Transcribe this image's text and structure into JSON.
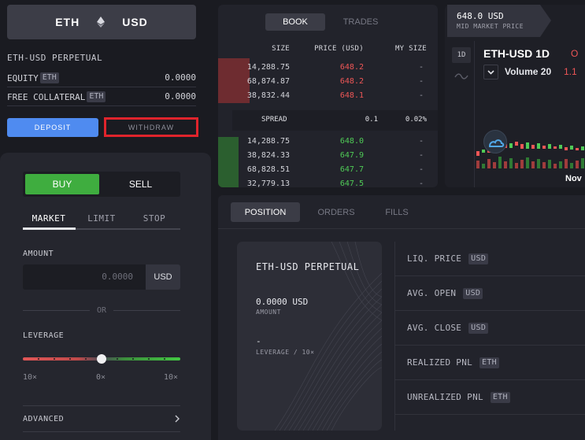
{
  "market": {
    "base": "ETH",
    "quote": "USD",
    "name": "ETH-USD PERPETUAL"
  },
  "account": {
    "equity_label": "EQUITY",
    "equity_tag": "ETH",
    "equity_value": "0.0000",
    "collateral_label": "FREE COLLATERAL",
    "collateral_tag": "ETH",
    "collateral_value": "0.0000",
    "deposit_label": "DEPOSIT",
    "withdraw_label": "WITHDRAW"
  },
  "trade": {
    "buy_label": "BUY",
    "sell_label": "SELL",
    "order_tabs": [
      "MARKET",
      "LIMIT",
      "STOP"
    ],
    "amount_label": "AMOUNT",
    "amount_placeholder": "0.0000",
    "amount_unit": "USD",
    "or_label": "OR",
    "leverage_label": "LEVERAGE",
    "leverage_ticks": [
      "10×",
      "0×",
      "10×"
    ],
    "leverage_value": 0,
    "advanced_label": "ADVANCED"
  },
  "orderbook": {
    "tabs": [
      "BOOK",
      "TRADES"
    ],
    "headers": {
      "size": "SIZE",
      "price": "PRICE (USD)",
      "my_size": "MY SIZE"
    },
    "asks": [
      {
        "size": "14,288.75",
        "price": "648.2",
        "my": "-"
      },
      {
        "size": "68,874.87",
        "price": "648.2",
        "my": "-"
      },
      {
        "size": "38,832.44",
        "price": "648.1",
        "my": "-"
      }
    ],
    "spread": {
      "label": "SPREAD",
      "value": "0.1",
      "percent": "0.02%"
    },
    "bids": [
      {
        "size": "14,288.75",
        "price": "648.0",
        "my": "-"
      },
      {
        "size": "38,824.33",
        "price": "647.9",
        "my": "-"
      },
      {
        "size": "68,828.51",
        "price": "647.7",
        "my": "-"
      },
      {
        "size": "32,779.13",
        "price": "647.5",
        "my": "-"
      }
    ]
  },
  "chart": {
    "mid_price": "648.0 USD",
    "mid_label": "MID MARKET PRICE",
    "timeframe": "1D",
    "symbol": "ETH-USD  1D",
    "open_prefix": "O",
    "volume_label": "Volume 20",
    "volume_value": "1.1",
    "month_label": "Nov"
  },
  "position": {
    "tabs": [
      "POSITION",
      "ORDERS",
      "FILLS"
    ],
    "card_title": "ETH-USD PERPETUAL",
    "amount_value": "0.0000 USD",
    "amount_label": "AMOUNT",
    "leverage_value": "-",
    "leverage_label": "LEVERAGE / 10×",
    "stats": [
      {
        "label": "LIQ. PRICE",
        "tag": "USD"
      },
      {
        "label": "AVG. OPEN",
        "tag": "USD"
      },
      {
        "label": "AVG. CLOSE",
        "tag": "USD"
      },
      {
        "label": "REALIZED PNL",
        "tag": "ETH"
      },
      {
        "label": "UNREALIZED PNL",
        "tag": "ETH"
      }
    ]
  },
  "colors": {
    "buy": "#3fad3f",
    "sell_price": "#ee5656",
    "accent": "#4f8bf0",
    "highlight": "#e0242c"
  }
}
